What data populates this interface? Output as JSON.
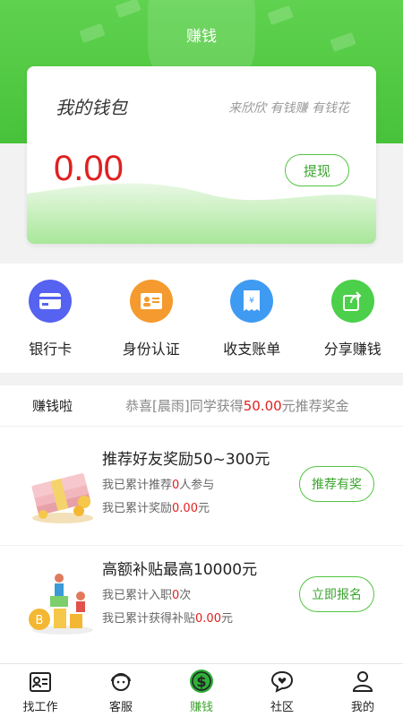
{
  "header": {
    "title": "赚钱"
  },
  "wallet": {
    "title": "我的钱包",
    "slogan": "来欣欣 有钱赚 有钱花",
    "amount": "0.00",
    "withdraw_label": "提现"
  },
  "shortcuts": [
    {
      "label": "银行卡",
      "icon": "bank-card-icon",
      "color": "#5662f0"
    },
    {
      "label": "身份认证",
      "icon": "id-card-icon",
      "color": "#f59a2e"
    },
    {
      "label": "收支账单",
      "icon": "bill-icon",
      "color": "#3f9bf2"
    },
    {
      "label": "分享赚钱",
      "icon": "share-icon",
      "color": "#4ccf4a"
    }
  ],
  "earn": {
    "label": "赚钱啦",
    "ticker": {
      "prefix": "恭喜[晨雨]同学获得",
      "amount": "50.00",
      "suffix": "元推荐奖金"
    }
  },
  "tasks": [
    {
      "title": "推荐好友奖励50~300元",
      "line1": {
        "prefix": "我已累计推荐",
        "value": "0",
        "suffix": "人参与"
      },
      "line2": {
        "prefix": "我已累计奖励",
        "value": "0.00",
        "suffix": "元"
      },
      "button": "推荐有奖",
      "icon": "money-stack-icon"
    },
    {
      "title": "高额补贴最高10000元",
      "line1": {
        "prefix": "我已累计入职",
        "value": "0",
        "suffix": "次"
      },
      "line2": {
        "prefix": "我已累计获得补贴",
        "value": "0.00",
        "suffix": "元"
      },
      "button": "立即报名",
      "icon": "bitcoin-people-icon"
    }
  ],
  "tabbar": [
    {
      "label": "找工作",
      "icon": "job-card-icon",
      "active": false
    },
    {
      "label": "客服",
      "icon": "headset-icon",
      "active": false
    },
    {
      "label": "赚钱",
      "icon": "dollar-icon",
      "active": true
    },
    {
      "label": "社区",
      "icon": "chat-heart-icon",
      "active": false
    },
    {
      "label": "我的",
      "icon": "person-icon",
      "active": false
    }
  ],
  "colors": {
    "accent": "#4ac23b",
    "amount_red": "#e02020"
  }
}
